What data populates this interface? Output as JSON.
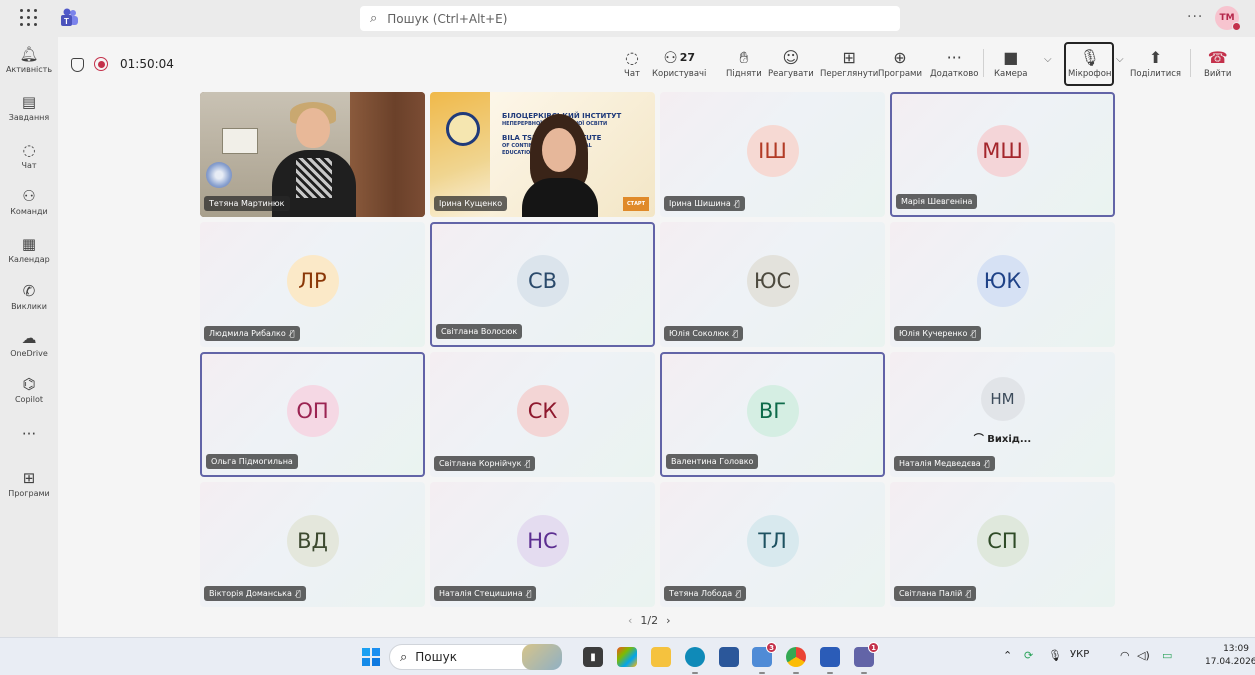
{
  "topbar": {
    "search_placeholder": "Пошук (Ctrl+Alt+E)",
    "more": "···",
    "user_initials": "ТМ"
  },
  "rail": [
    {
      "icon": "bell-icon",
      "label": "Активність"
    },
    {
      "icon": "clipboard-icon",
      "label": "Завдання"
    },
    {
      "icon": "chat-icon",
      "label": "Чат"
    },
    {
      "icon": "teams-icon",
      "label": "Команди"
    },
    {
      "icon": "calendar-icon",
      "label": "Календар"
    },
    {
      "icon": "phone-icon",
      "label": "Виклики"
    },
    {
      "icon": "cloud-icon",
      "label": "OneDrive"
    },
    {
      "icon": "copilot-icon",
      "label": "Copilot"
    },
    {
      "icon": "more-icon",
      "label": ""
    },
    {
      "icon": "add-app-icon",
      "label": "Програми"
    }
  ],
  "meeting": {
    "timer": "01:50:04",
    "participant_count": "27",
    "buttons": {
      "chat": "Чат",
      "people": "Користувачі",
      "raise": "Підняти",
      "react": "Реагувати",
      "view": "Переглянути",
      "apps": "Програми",
      "more": "Додатково",
      "camera": "Камера",
      "mic": "Мікрофон",
      "share": "Поділитися",
      "leave": "Вийти"
    }
  },
  "participants": [
    {
      "name": "Тетяна Мартинюк",
      "type": "video",
      "muted": false,
      "active": false
    },
    {
      "name": "Ірина Кущенко",
      "type": "video",
      "muted": false,
      "active": false
    },
    {
      "name": "Ірина Шишина",
      "initials": "ІШ",
      "muted": true,
      "active": false,
      "color": "#f6d9d3",
      "text_color": "#b23b26"
    },
    {
      "name": "Марія Шевгеніна",
      "initials": "МШ",
      "muted": false,
      "active": true,
      "color": "#f4d5d8",
      "text_color": "#a4262c"
    },
    {
      "name": "Людмила Рибалко",
      "initials": "ЛР",
      "muted": true,
      "active": false,
      "color": "#fbe9c8",
      "text_color": "#8a3707"
    },
    {
      "name": "Світлана Волосюк",
      "initials": "СВ",
      "muted": false,
      "active": true,
      "color": "#dbe4ec",
      "text_color": "#2b4a6b"
    },
    {
      "name": "Юлія Соколюк",
      "initials": "ЮС",
      "muted": true,
      "active": false,
      "color": "#e3e2dc",
      "text_color": "#4d4a3f"
    },
    {
      "name": "Юлія Кучеренко",
      "initials": "ЮК",
      "muted": true,
      "active": false,
      "color": "#d6e1f4",
      "text_color": "#1f4287"
    },
    {
      "name": "Ольга Підмогильна",
      "initials": "ОП",
      "muted": false,
      "active": true,
      "color": "#f5d8e4",
      "text_color": "#9b2452"
    },
    {
      "name": "Світлана Корнійчук",
      "initials": "СК",
      "muted": true,
      "active": false,
      "color": "#f3d5d5",
      "text_color": "#8e192e"
    },
    {
      "name": "Валентина Головко",
      "initials": "ВГ",
      "muted": false,
      "active": true,
      "color": "#d5eee3",
      "text_color": "#0e6b4a"
    },
    {
      "name": "Наталія Медведєва",
      "initials": "НМ",
      "muted": true,
      "active": false,
      "color": "#e1e4e8",
      "text_color": "#3b4a5a",
      "status": "Вихід..."
    },
    {
      "name": "Вікторія Доманська",
      "initials": "ВД",
      "muted": true,
      "active": false,
      "color": "#e4e7dc",
      "text_color": "#3d4a30"
    },
    {
      "name": "Наталія Стецишина",
      "initials": "НС",
      "muted": true,
      "active": false,
      "color": "#e4dcf0",
      "text_color": "#5c2e91"
    },
    {
      "name": "Тетяна Лобода",
      "initials": "ТЛ",
      "muted": true,
      "active": false,
      "color": "#d8e9ee",
      "text_color": "#1e5261"
    },
    {
      "name": "Світлана Палій",
      "initials": "СП",
      "muted": true,
      "active": false,
      "color": "#dfe8dc",
      "text_color": "#2f4b27"
    }
  ],
  "video_banner": {
    "line1": "БІЛОЦЕРКІВСЬКИЙ ІНСТИТУТ",
    "line2": "НЕПЕРЕРВНОЇ ПРОФЕСІЙНОЇ ОСВІТИ",
    "line3": "BILA TSERKVA INSTITUTE",
    "line4": "OF CONTINUING PROFESSIONAL",
    "line5": "EDUCATION",
    "badge": "СТАРТ"
  },
  "pager": {
    "text": "1/2"
  },
  "taskbar": {
    "search": "Пошук",
    "language": "УКР",
    "time": "13:09",
    "date": "17.04.2026",
    "badge_chrome": "3",
    "badge_teams": "1"
  },
  "colors": {
    "accent": "#6264a7",
    "danger": "#c4314b"
  }
}
